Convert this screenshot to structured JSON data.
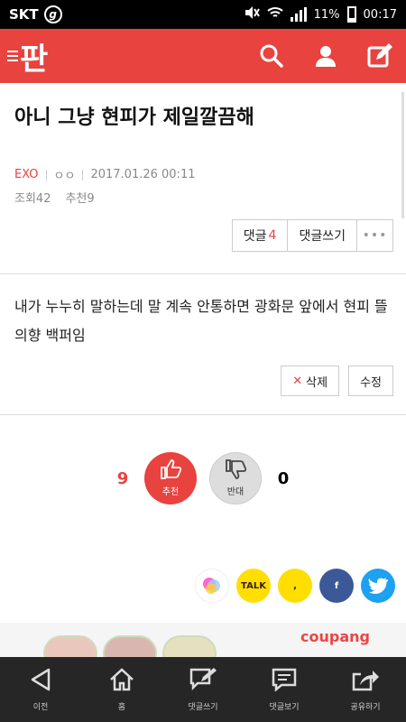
{
  "status_bar": {
    "carrier": "SKT",
    "carrier_badge": "g",
    "battery": "11%",
    "time": "00:17"
  },
  "header": {
    "logo": "판",
    "icons": [
      "search-icon",
      "user-icon",
      "write-icon"
    ]
  },
  "article": {
    "title": "아니 그냥 현피가 제일깔끔해",
    "author": "EXO",
    "author2": "ㅇㅇ",
    "date": "2017.01.26 00:11",
    "views_label": "조회",
    "views": "42",
    "recommend_label": "추천",
    "recommend": "9",
    "comment_label": "댓글",
    "comment_count": "4",
    "write_comment": "댓글쓰기",
    "more": "•••"
  },
  "body": {
    "text": "내가 누누히 말하는데 말 계속 안통하면 광화문 앞에서 현피 뜰 의향 백퍼임",
    "delete": "삭제",
    "edit": "수정"
  },
  "vote": {
    "up_count": "9",
    "up_label": "추천",
    "down_label": "반대",
    "down_count": "0",
    "colors": {
      "up": "#e8433f",
      "down": "#dddddd"
    }
  },
  "share": {
    "items": [
      {
        "name": "kakaostory-icon",
        "label": ""
      },
      {
        "name": "kakaotalk-icon",
        "label": "TALK"
      },
      {
        "name": "yellow-quote-icon",
        "label": ","
      },
      {
        "name": "facebook-icon",
        "label": "f"
      },
      {
        "name": "twitter-icon",
        "label": ""
      }
    ]
  },
  "ad": {
    "brand": "coupang"
  },
  "bottom_nav": [
    {
      "icon": "back-icon",
      "label": "이전"
    },
    {
      "icon": "home-icon",
      "label": "홈"
    },
    {
      "icon": "write-comment-icon",
      "label": "댓글쓰기"
    },
    {
      "icon": "view-comments-icon",
      "label": "댓글보기"
    },
    {
      "icon": "share-icon",
      "label": "공유하기"
    }
  ],
  "colors": {
    "brand": "#e8433f",
    "status_bar": "#000000",
    "bottom_bar": "#262626"
  }
}
